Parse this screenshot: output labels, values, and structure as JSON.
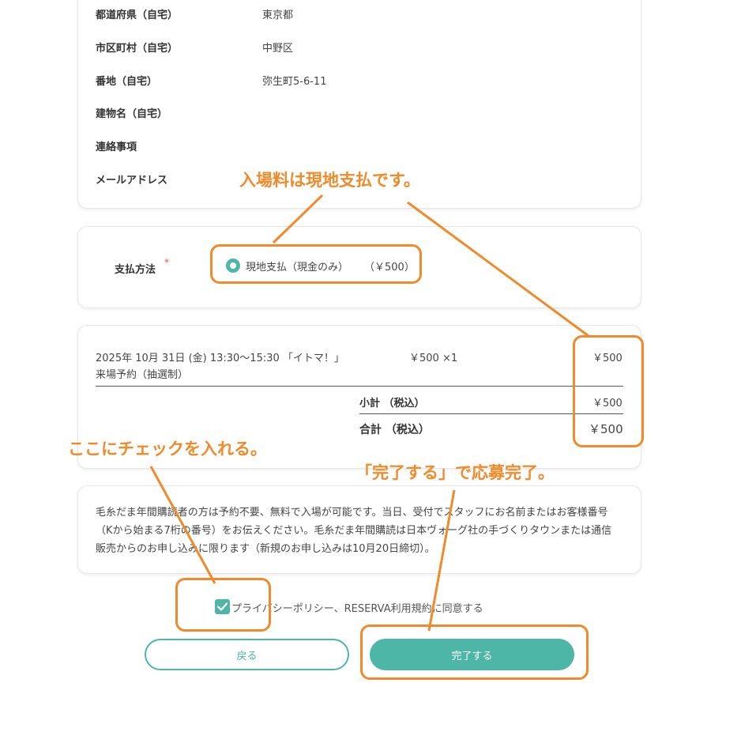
{
  "address": {
    "prefecture": {
      "label": "都道府県（自宅）",
      "value": "東京都"
    },
    "city": {
      "label": "市区町村（自宅）",
      "value": "中野区"
    },
    "street": {
      "label": "番地（自宅）",
      "value": "弥生町5-6-11"
    },
    "building": {
      "label": "建物名（自宅）",
      "value": ""
    },
    "notes": {
      "label": "連絡事項",
      "value": ""
    },
    "email": {
      "label": "メールアドレス",
      "value": ""
    }
  },
  "payment": {
    "label": "支払方法",
    "required_mark": "*",
    "option": "現地支払（現金のみ）",
    "option_price": "（￥500）"
  },
  "order": {
    "item_line1": "2025年 10月 31日 (金) 13:30〜15:30 「イトマ！」",
    "item_line2": "来場予約（抽選制）",
    "unit_qty": "￥500 ×1",
    "item_price": "￥500",
    "subtotal_label": "小計 （税込）",
    "subtotal_value": "￥500",
    "total_label": "合計 （税込）",
    "total_value": "￥500"
  },
  "notice": {
    "text": "毛糸だま年間購読者の方は予約不要、無料で入場が可能です。当日、受付でスタッフにお名前またはお客様番号（Kから始まる7桁の番号）をお伝えください。毛糸だま年間購読は日本ヴォーグ社の手づくりタウンまたは通信販売からのお申し込みに限ります（新規のお申し込みは10月20日締切）。"
  },
  "agreement": {
    "label": "プライバシーポリシー、RESERVA利用規約に同意する",
    "checked": true
  },
  "buttons": {
    "back": "戻る",
    "complete": "完了する"
  },
  "annotations": {
    "onsite_payment": "入場料は現地支払です。",
    "check_here": "ここにチェックを入れる。",
    "complete_apply": "「完了する」で応募完了。"
  },
  "colors": {
    "accent": "#4db6a6",
    "annotation": "#f08a2a",
    "required": "#e05050"
  }
}
